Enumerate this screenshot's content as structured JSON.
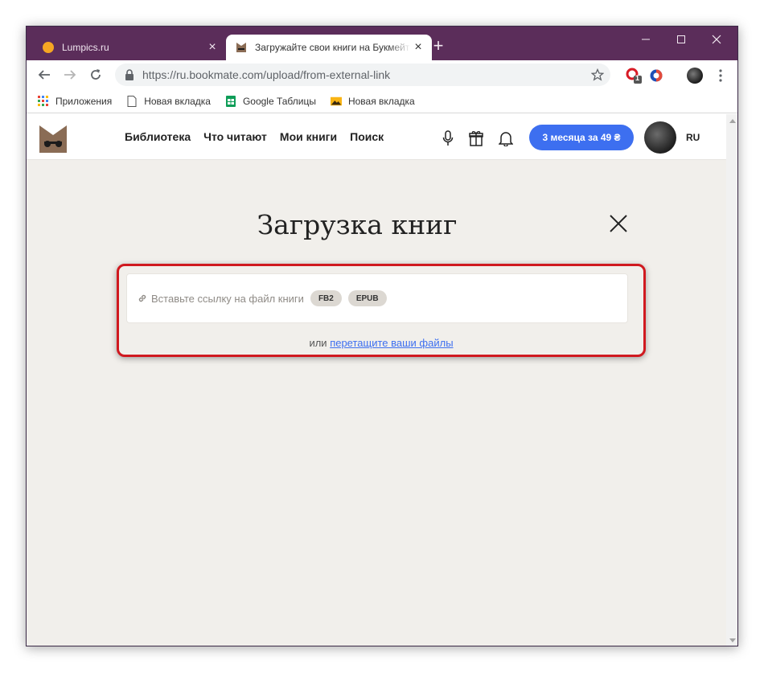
{
  "browser": {
    "tabs": [
      {
        "title": "Lumpics.ru",
        "active": false
      },
      {
        "title": "Загружайте свои книги на Букмейт",
        "active": true
      }
    ],
    "url_display": "https://ru.bookmate.com/upload/from-external-link",
    "extension_badge": "1"
  },
  "bookmarks": [
    {
      "label": "Приложения",
      "icon": "apps-grid-icon"
    },
    {
      "label": "Новая вкладка",
      "icon": "page-icon"
    },
    {
      "label": "Google Таблицы",
      "icon": "sheets-icon"
    },
    {
      "label": "Новая вкладка",
      "icon": "image-icon"
    }
  ],
  "site": {
    "nav": [
      "Библиотека",
      "Что читают",
      "Мои книги",
      "Поиск"
    ],
    "promo_label": "3 месяца за 49 ₴",
    "lang": "RU"
  },
  "upload": {
    "title": "Загрузка книг",
    "placeholder": "Вставьте ссылку на файл книги",
    "formats": [
      "FB2",
      "EPUB"
    ],
    "or_text": "или",
    "drag_link": "перетащите ваши файлы"
  },
  "colors": {
    "tabstrip": "#5b2d5a",
    "accent_blue": "#3d6ff0",
    "highlight_red": "#d0191f",
    "page_bg": "#f1efeb"
  }
}
